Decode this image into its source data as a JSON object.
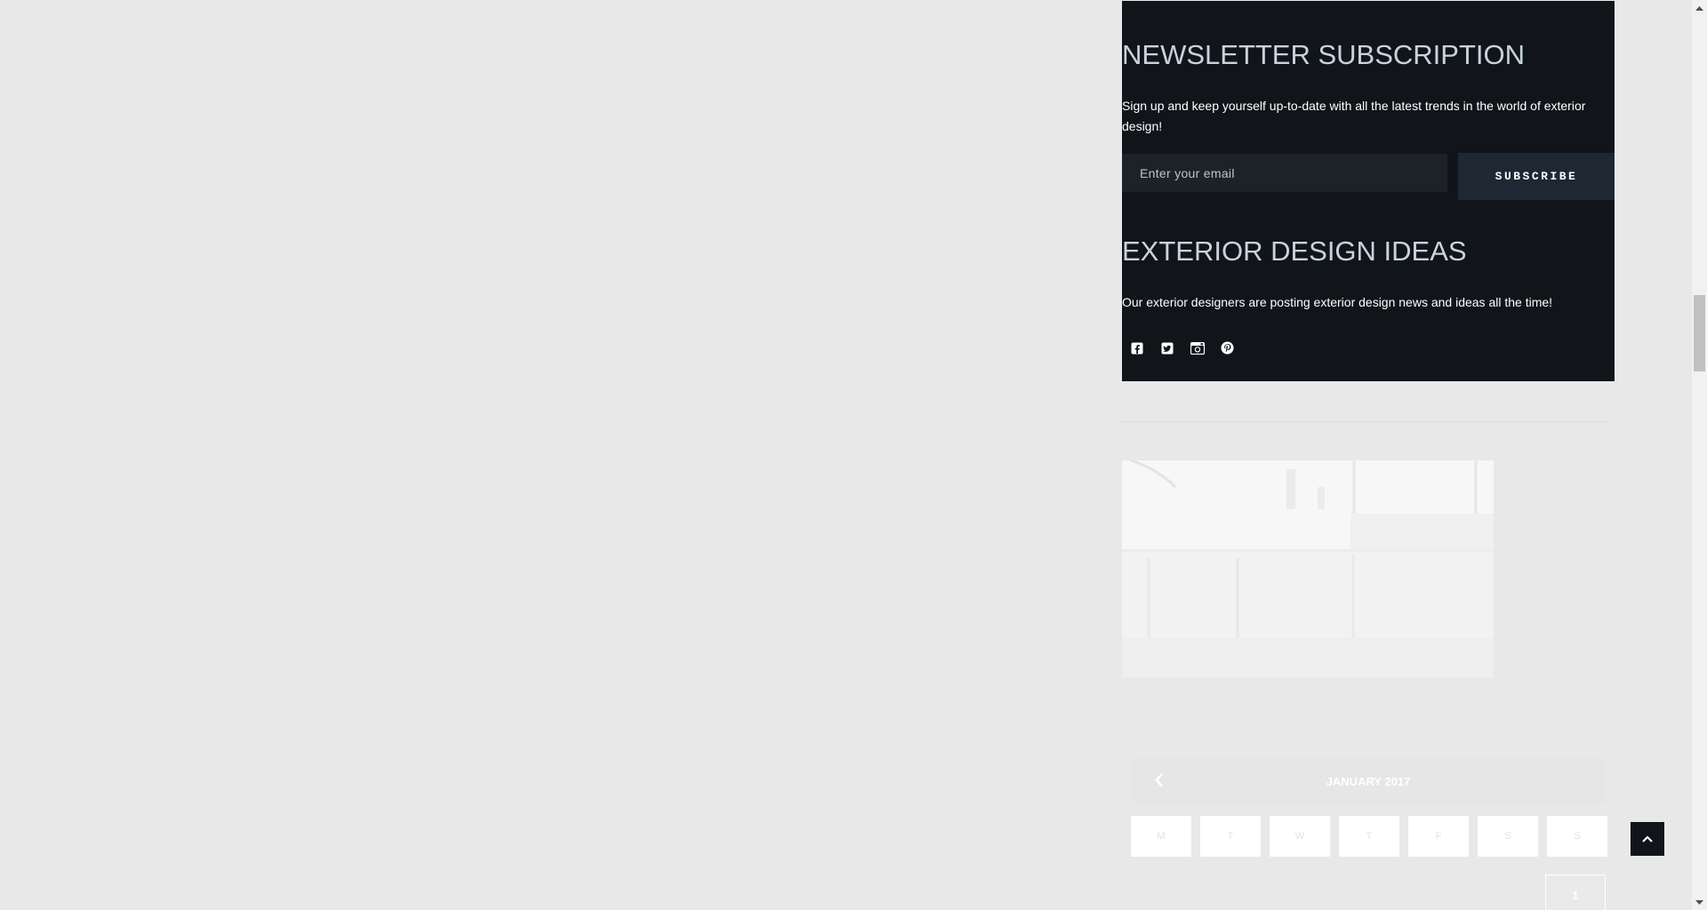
{
  "newsletter": {
    "title": "NEWSLETTER SUBSCRIPTION",
    "text": "Sign up and keep yourself up-to-date with all the latest trends in the world of exterior design!",
    "email_placeholder": "Enter your email",
    "subscribe_label": "SUBSCRIBE"
  },
  "exterior": {
    "title": "EXTERIOR DESIGN IDEAS",
    "text": "Our exterior designers are posting exterior design news and ideas all the time!",
    "social_icons": [
      "facebook-icon",
      "twitter-icon",
      "instagram-icon",
      "pinterest-icon"
    ]
  },
  "calendar": {
    "month": "JANUARY 2017",
    "weekdays": [
      "M",
      "T",
      "W",
      "T",
      "F",
      "S",
      "S"
    ],
    "dates": [
      "1"
    ]
  },
  "colors": {
    "page_bg": "#e8e8e8",
    "dark_box_bg": "#11151a",
    "heading": "#c8d3de",
    "button_bg": "#1f2733"
  }
}
